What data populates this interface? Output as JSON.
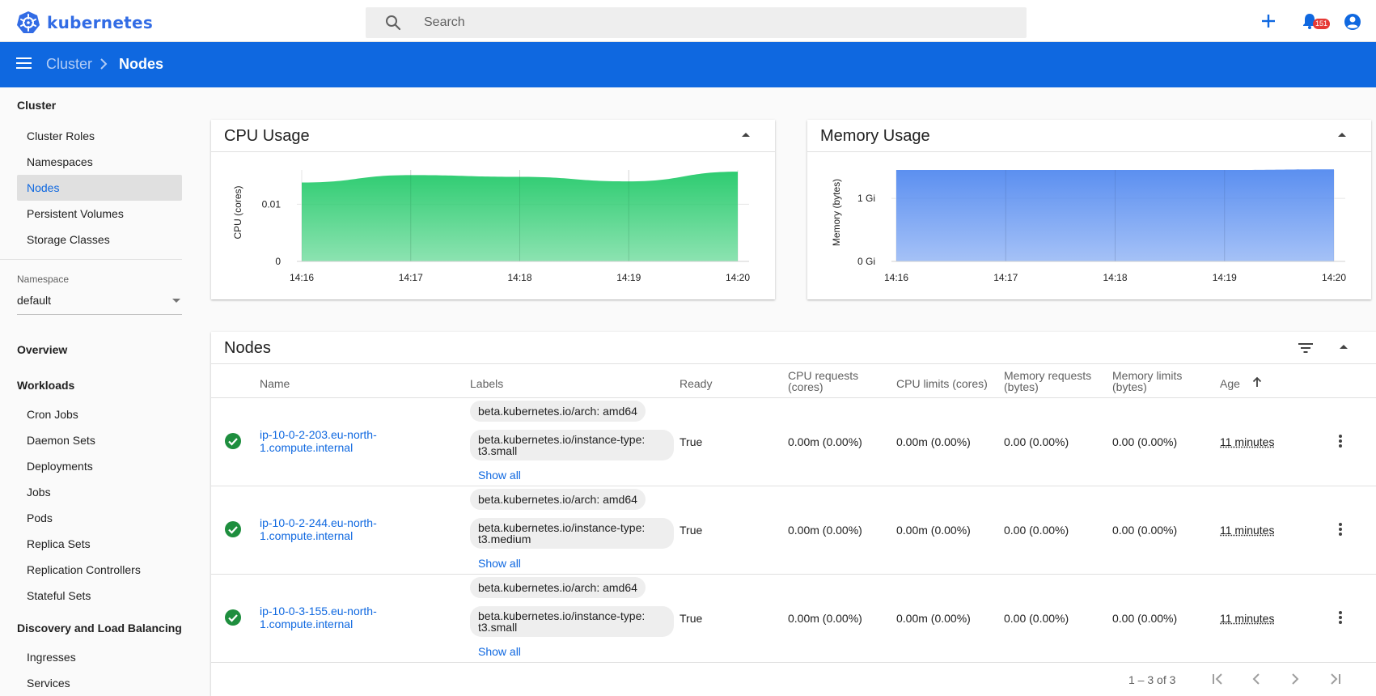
{
  "app": {
    "logo_text": "kubernetes"
  },
  "search": {
    "placeholder": "Search"
  },
  "notifications": {
    "count": "151"
  },
  "breadcrumb": {
    "parent": "Cluster",
    "current": "Nodes"
  },
  "sidebar": {
    "cluster_title": "Cluster",
    "cluster_items": [
      "Cluster Roles",
      "Namespaces",
      "Nodes",
      "Persistent Volumes",
      "Storage Classes"
    ],
    "namespace_label": "Namespace",
    "namespace_value": "default",
    "overview": "Overview",
    "workloads_title": "Workloads",
    "workloads_items": [
      "Cron Jobs",
      "Daemon Sets",
      "Deployments",
      "Jobs",
      "Pods",
      "Replica Sets",
      "Replication Controllers",
      "Stateful Sets"
    ],
    "discovery_title": "Discovery and Load Balancing",
    "discovery_items": [
      "Ingresses",
      "Services"
    ]
  },
  "cpu_card": {
    "title": "CPU Usage"
  },
  "memory_card": {
    "title": "Memory Usage"
  },
  "chart_data": [
    {
      "type": "area",
      "title": "CPU Usage",
      "ylabel": "CPU (cores)",
      "xlabel": "",
      "x": [
        "14:16",
        "14:17",
        "14:18",
        "14:19",
        "14:20"
      ],
      "y_ticks": [
        "0",
        "0.01"
      ],
      "ylim": [
        0,
        0.016
      ],
      "series": [
        {
          "values": [
            0.0138,
            0.0151,
            0.0148,
            0.014,
            0.0157
          ],
          "color": "#2ecc71"
        }
      ]
    },
    {
      "type": "area",
      "title": "Memory Usage",
      "ylabel": "Memory (bytes)",
      "xlabel": "",
      "x": [
        "14:16",
        "14:17",
        "14:18",
        "14:19",
        "14:20"
      ],
      "y_ticks": [
        "0 Gi",
        "1 Gi"
      ],
      "ylim": [
        0,
        1.45
      ],
      "series": [
        {
          "values": [
            1.45,
            1.45,
            1.45,
            1.45,
            1.46
          ],
          "color": "#5b8ff0"
        }
      ]
    }
  ],
  "nodes_card": {
    "title": "Nodes",
    "columns": [
      "Name",
      "Labels",
      "Ready",
      "CPU requests (cores)",
      "CPU limits (cores)",
      "Memory requests (bytes)",
      "Memory limits (bytes)",
      "Age"
    ],
    "rows": [
      {
        "name": "ip-10-0-2-203.eu-north-1.compute.internal",
        "label1": "beta.kubernetes.io/arch: amd64",
        "label2": "beta.kubernetes.io/instance-type: t3.small",
        "show_all": "Show all",
        "ready": "True",
        "cpu_req": "0.00m (0.00%)",
        "cpu_lim": "0.00m (0.00%)",
        "mem_req": "0.00 (0.00%)",
        "mem_lim": "0.00 (0.00%)",
        "age": "11 minutes"
      },
      {
        "name": "ip-10-0-2-244.eu-north-1.compute.internal",
        "label1": "beta.kubernetes.io/arch: amd64",
        "label2": "beta.kubernetes.io/instance-type: t3.medium",
        "show_all": "Show all",
        "ready": "True",
        "cpu_req": "0.00m (0.00%)",
        "cpu_lim": "0.00m (0.00%)",
        "mem_req": "0.00 (0.00%)",
        "mem_lim": "0.00 (0.00%)",
        "age": "11 minutes"
      },
      {
        "name": "ip-10-0-3-155.eu-north-1.compute.internal",
        "label1": "beta.kubernetes.io/arch: amd64",
        "label2": "beta.kubernetes.io/instance-type: t3.small",
        "show_all": "Show all",
        "ready": "True",
        "cpu_req": "0.00m (0.00%)",
        "cpu_lim": "0.00m (0.00%)",
        "mem_req": "0.00 (0.00%)",
        "mem_lim": "0.00 (0.00%)",
        "age": "11 minutes"
      }
    ],
    "pagination": "1 – 3 of 3"
  },
  "colors": {
    "brand_blue": "#0f68e0",
    "cpu_green": "#2ecc71",
    "memory_blue": "#5b8ff0",
    "status_ok": "#1e8e3e"
  }
}
